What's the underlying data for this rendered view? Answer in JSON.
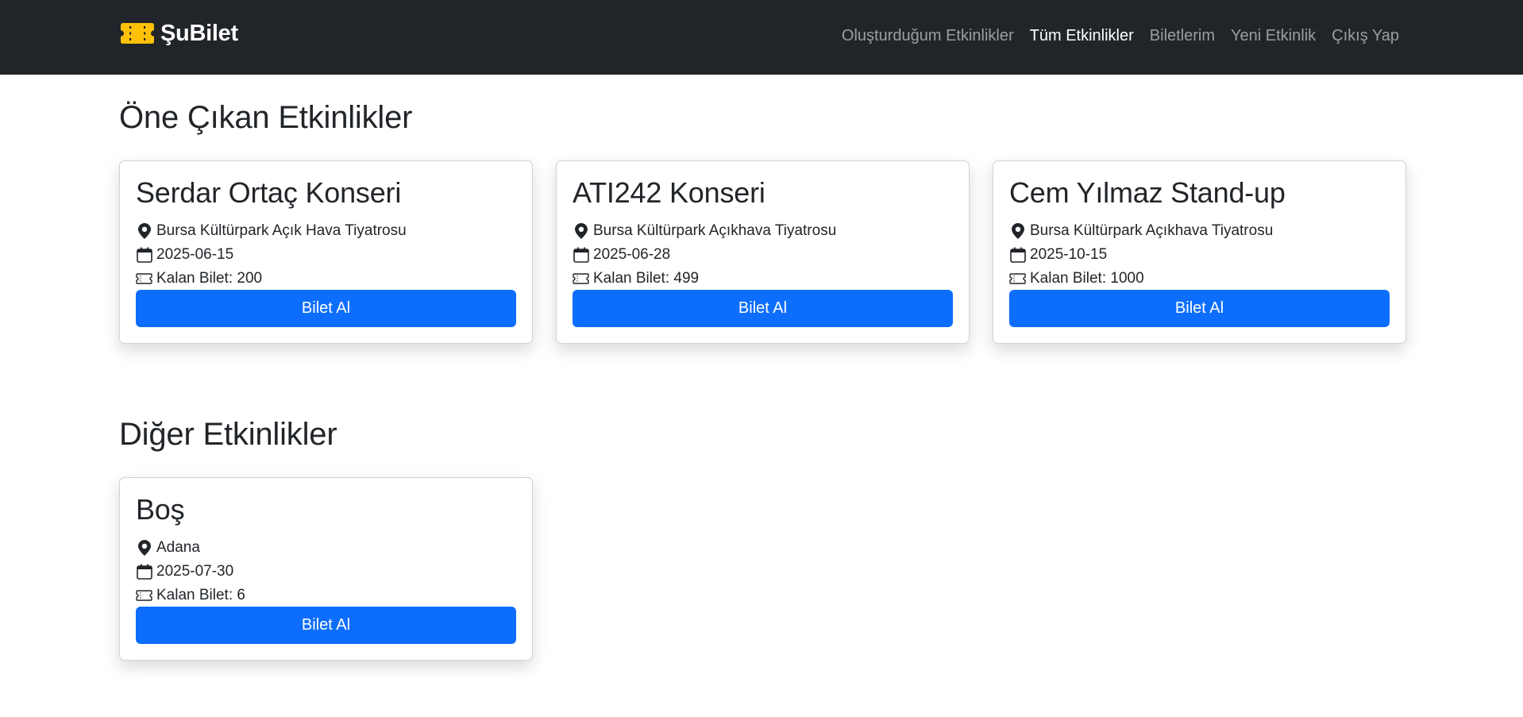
{
  "brand": {
    "name": "ŞuBilet",
    "icon": "ticket-icon",
    "icon_color": "#ffc107"
  },
  "nav": [
    {
      "label": "Oluşturduğum Etkinlikler",
      "active": false
    },
    {
      "label": "Tüm Etkinlikler",
      "active": true
    },
    {
      "label": "Biletlerim",
      "active": false
    },
    {
      "label": "Yeni Etkinlik",
      "active": false
    },
    {
      "label": "Çıkış Yap",
      "active": false
    }
  ],
  "featured": {
    "title": "Öne Çıkan Etkinlikler",
    "events": [
      {
        "name": "Serdar Ortaç Konseri",
        "location": "Bursa Kültürpark Açık Hava Tiyatrosu",
        "date": "2025-06-15",
        "tickets": "Kalan Bilet: 200",
        "button": "Bilet Al"
      },
      {
        "name": "ATI242 Konseri",
        "location": "Bursa Kültürpark Açıkhava Tiyatrosu",
        "date": "2025-06-28",
        "tickets": "Kalan Bilet: 499",
        "button": "Bilet Al"
      },
      {
        "name": "Cem Yılmaz Stand-up",
        "location": "Bursa Kültürpark Açıkhava Tiyatrosu",
        "date": "2025-10-15",
        "tickets": "Kalan Bilet: 1000",
        "button": "Bilet Al"
      }
    ]
  },
  "other": {
    "title": "Diğer Etkinlikler",
    "events": [
      {
        "name": "Boş",
        "location": "Adana",
        "date": "2025-07-30",
        "tickets": "Kalan Bilet: 6",
        "button": "Bilet Al"
      }
    ]
  },
  "icons": {
    "location": "map-pin-icon",
    "date": "calendar-icon",
    "tickets": "ticket-icon"
  },
  "colors": {
    "navbar": "#212529",
    "primary": "#0d6efd",
    "brand_accent": "#ffc107"
  }
}
